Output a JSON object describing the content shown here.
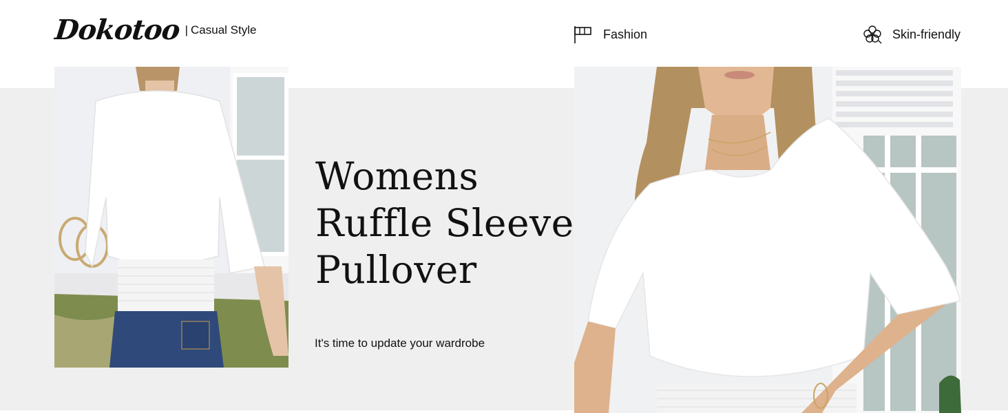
{
  "brand": {
    "logo": "Dokotoo",
    "separator": "|",
    "tagline": "Casual Style"
  },
  "features": [
    {
      "label": "Fashion",
      "icon": "flag-icon"
    },
    {
      "label": "Skin-friendly",
      "icon": "cotton-flower-icon"
    }
  ],
  "headline": {
    "line1": "Womens",
    "line2": "Ruffle Sleeve",
    "line3": "Pullover"
  },
  "subline": "It's time to update your wardrobe",
  "images": {
    "left": "back-view-photo",
    "right": "front-view-photo"
  },
  "colors": {
    "background": "#ffffff",
    "band": "#efefef",
    "text": "#111111"
  }
}
